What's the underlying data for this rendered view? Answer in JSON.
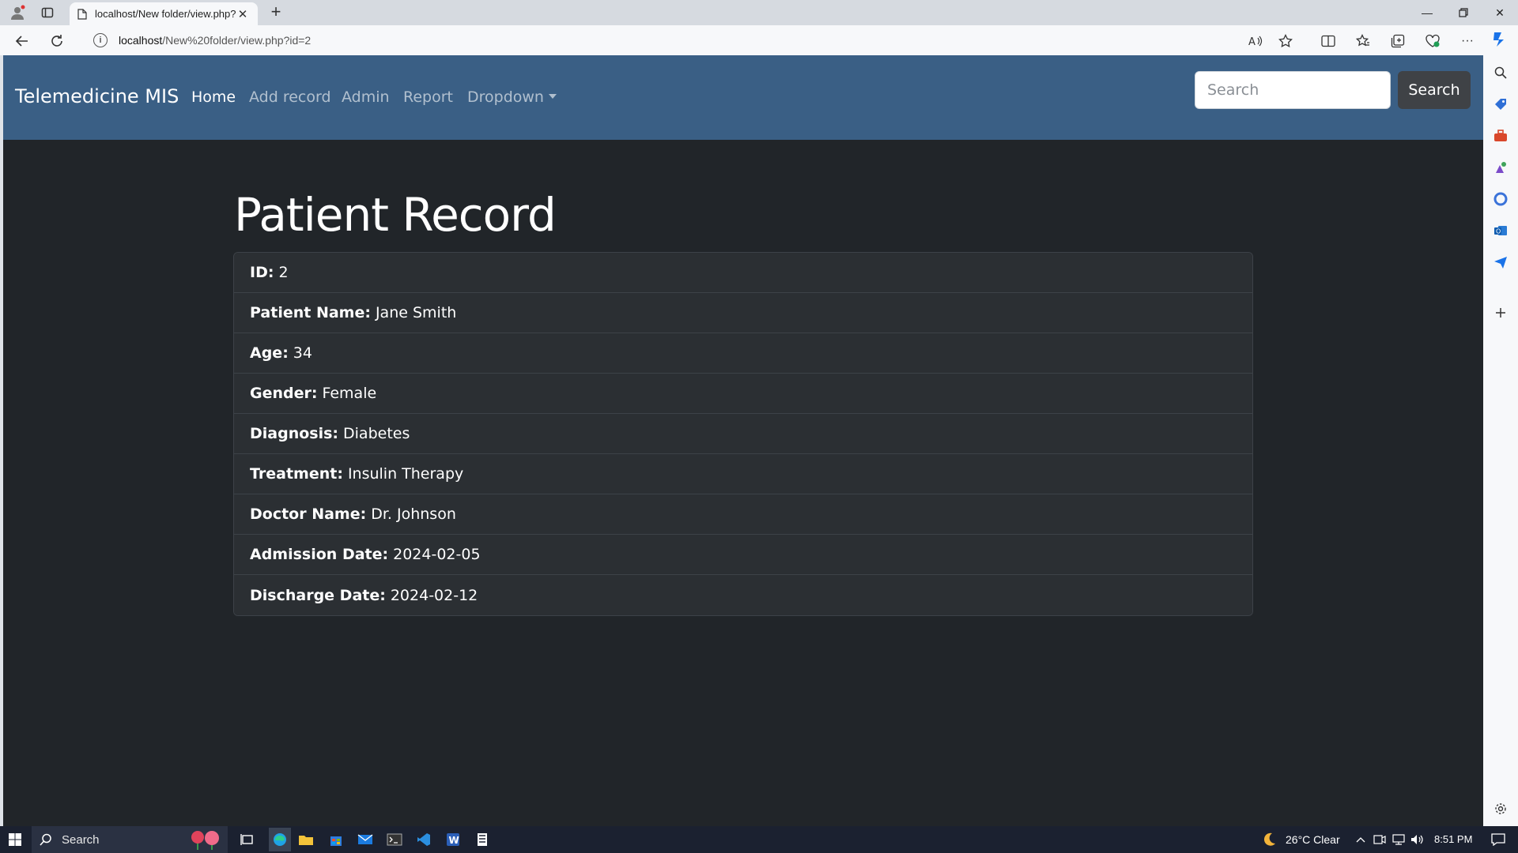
{
  "browser": {
    "tab_title": "localhost/New folder/view.php?i",
    "url_host": "localhost",
    "url_path": "/New%20folder/view.php?id=2"
  },
  "site": {
    "brand": "Telemedicine MIS",
    "nav": [
      {
        "label": "Home",
        "active": true
      },
      {
        "label": "Add record",
        "active": false
      },
      {
        "label": "Admin",
        "active": false
      },
      {
        "label": "Report",
        "active": false
      },
      {
        "label": "Dropdown",
        "active": false
      }
    ],
    "search": {
      "placeholder": "Search",
      "button_label": "Search"
    }
  },
  "page": {
    "title": "Patient Record",
    "fields": [
      {
        "label": "ID:",
        "value": "2"
      },
      {
        "label": "Patient Name:",
        "value": "Jane Smith"
      },
      {
        "label": "Age:",
        "value": "34"
      },
      {
        "label": "Gender:",
        "value": "Female"
      },
      {
        "label": "Diagnosis:",
        "value": "Diabetes"
      },
      {
        "label": "Treatment:",
        "value": "Insulin Therapy"
      },
      {
        "label": "Doctor Name:",
        "value": "Dr. Johnson"
      },
      {
        "label": "Admission Date:",
        "value": "2024-02-05"
      },
      {
        "label": "Discharge Date:",
        "value": "2024-02-12"
      }
    ]
  },
  "taskbar": {
    "search_label": "Search",
    "weather": "26°C  Clear",
    "time": "8:51 PM"
  },
  "colors": {
    "navbar_bg": "#3a5f85",
    "page_bg": "#212529",
    "list_item_bg": "#2b2f33"
  }
}
